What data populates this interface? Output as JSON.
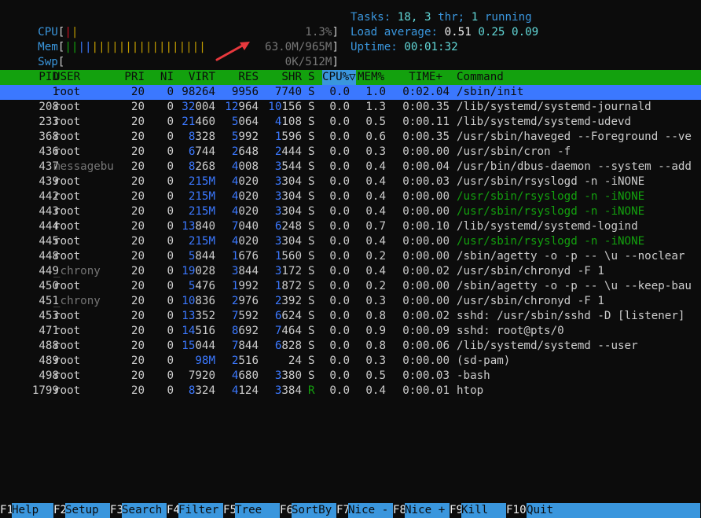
{
  "meters": {
    "cpu": {
      "label": "CPU",
      "value": "1.3%"
    },
    "mem": {
      "label": "Mem",
      "value": "63.0M/965M"
    },
    "swp": {
      "label": "Swp",
      "value": "0K/512M"
    }
  },
  "summary": {
    "tasks_label": "Tasks:",
    "tasks": "18,",
    "thr": "3",
    "thr_label": "thr;",
    "running": "1",
    "running_label": "running",
    "load_label": "Load average:",
    "load1": "0.51",
    "load5": "0.25",
    "load15": "0.09",
    "uptime_label": "Uptime:",
    "uptime": "00:01:32"
  },
  "columns": {
    "pid": "PID",
    "user": "USER",
    "pri": "PRI",
    "ni": "NI",
    "virt": "VIRT",
    "res": "RES",
    "shr": "SHR",
    "s": "S",
    "cpu": "CPU%▽",
    "mem": "MEM%",
    "time": "TIME+",
    "command": "Command"
  },
  "processes": [
    {
      "pid": "1",
      "user": "root",
      "pri": "20",
      "ni": "0",
      "virt_h": "98",
      "virt_t": "264",
      "res_h": "9",
      "res_t": "956",
      "shr_h": "7",
      "shr_t": "740",
      "s": "S",
      "cpu": "0.0",
      "mem": "1.0",
      "time": "0:02.04",
      "cmd": "/sbin/init"
    },
    {
      "pid": "208",
      "user": "root",
      "pri": "20",
      "ni": "0",
      "virt_h": "32",
      "virt_t": "004",
      "res_h": "12",
      "res_t": "964",
      "shr_h": "10",
      "shr_t": "156",
      "s": "S",
      "cpu": "0.0",
      "mem": "1.3",
      "time": "0:00.35",
      "cmd": "/lib/systemd/systemd-journald"
    },
    {
      "pid": "233",
      "user": "root",
      "pri": "20",
      "ni": "0",
      "virt_h": "21",
      "virt_t": "460",
      "res_h": "5",
      "res_t": "064",
      "shr_h": "4",
      "shr_t": "108",
      "s": "S",
      "cpu": "0.0",
      "mem": "0.5",
      "time": "0:00.11",
      "cmd": "/lib/systemd/systemd-udevd"
    },
    {
      "pid": "368",
      "user": "root",
      "pri": "20",
      "ni": "0",
      "virt_h": "8",
      "virt_t": "328",
      "res_h": "5",
      "res_t": "992",
      "shr_h": "1",
      "shr_t": "596",
      "s": "S",
      "cpu": "0.0",
      "mem": "0.6",
      "time": "0:00.35",
      "cmd": "/usr/sbin/haveged --Foreground --ve"
    },
    {
      "pid": "436",
      "user": "root",
      "pri": "20",
      "ni": "0",
      "virt_h": "6",
      "virt_t": "744",
      "res_h": "2",
      "res_t": "648",
      "shr_h": "2",
      "shr_t": "444",
      "s": "S",
      "cpu": "0.0",
      "mem": "0.3",
      "time": "0:00.00",
      "cmd": "/usr/sbin/cron -f"
    },
    {
      "pid": "437",
      "user": "messagebu",
      "pri": "20",
      "ni": "0",
      "virt_h": "8",
      "virt_t": "268",
      "res_h": "4",
      "res_t": "008",
      "shr_h": "3",
      "shr_t": "544",
      "s": "S",
      "cpu": "0.0",
      "mem": "0.4",
      "time": "0:00.04",
      "cmd": "/usr/bin/dbus-daemon --system --add"
    },
    {
      "pid": "439",
      "user": "root",
      "pri": "20",
      "ni": "0",
      "virt_h": "215M",
      "virt_t": "",
      "res_h": "4",
      "res_t": "020",
      "shr_h": "3",
      "shr_t": "304",
      "s": "S",
      "cpu": "0.0",
      "mem": "0.4",
      "time": "0:00.03",
      "cmd": "/usr/sbin/rsyslogd -n -iNONE"
    },
    {
      "pid": "442",
      "user": "root",
      "pri": "20",
      "ni": "0",
      "virt_h": "215M",
      "virt_t": "",
      "res_h": "4",
      "res_t": "020",
      "shr_h": "3",
      "shr_t": "304",
      "s": "S",
      "cpu": "0.0",
      "mem": "0.4",
      "time": "0:00.00",
      "cmd": "/usr/sbin/rsyslogd -n -iNONE",
      "thread": true
    },
    {
      "pid": "443",
      "user": "root",
      "pri": "20",
      "ni": "0",
      "virt_h": "215M",
      "virt_t": "",
      "res_h": "4",
      "res_t": "020",
      "shr_h": "3",
      "shr_t": "304",
      "s": "S",
      "cpu": "0.0",
      "mem": "0.4",
      "time": "0:00.00",
      "cmd": "/usr/sbin/rsyslogd -n -iNONE",
      "thread": true
    },
    {
      "pid": "444",
      "user": "root",
      "pri": "20",
      "ni": "0",
      "virt_h": "13",
      "virt_t": "840",
      "res_h": "7",
      "res_t": "040",
      "shr_h": "6",
      "shr_t": "248",
      "s": "S",
      "cpu": "0.0",
      "mem": "0.7",
      "time": "0:00.10",
      "cmd": "/lib/systemd/systemd-logind"
    },
    {
      "pid": "445",
      "user": "root",
      "pri": "20",
      "ni": "0",
      "virt_h": "215M",
      "virt_t": "",
      "res_h": "4",
      "res_t": "020",
      "shr_h": "3",
      "shr_t": "304",
      "s": "S",
      "cpu": "0.0",
      "mem": "0.4",
      "time": "0:00.00",
      "cmd": "/usr/sbin/rsyslogd -n -iNONE",
      "thread": true
    },
    {
      "pid": "448",
      "user": "root",
      "pri": "20",
      "ni": "0",
      "virt_h": "5",
      "virt_t": "844",
      "res_h": "1",
      "res_t": "676",
      "shr_h": "1",
      "shr_t": "560",
      "s": "S",
      "cpu": "0.0",
      "mem": "0.2",
      "time": "0:00.00",
      "cmd": "/sbin/agetty -o -p -- \\u --noclear"
    },
    {
      "pid": "449",
      "user": "_chrony",
      "pri": "20",
      "ni": "0",
      "virt_h": "19",
      "virt_t": "028",
      "res_h": "3",
      "res_t": "844",
      "shr_h": "3",
      "shr_t": "172",
      "s": "S",
      "cpu": "0.0",
      "mem": "0.4",
      "time": "0:00.02",
      "cmd": "/usr/sbin/chronyd -F 1"
    },
    {
      "pid": "450",
      "user": "root",
      "pri": "20",
      "ni": "0",
      "virt_h": "5",
      "virt_t": "476",
      "res_h": "1",
      "res_t": "992",
      "shr_h": "1",
      "shr_t": "872",
      "s": "S",
      "cpu": "0.0",
      "mem": "0.2",
      "time": "0:00.00",
      "cmd": "/sbin/agetty -o -p -- \\u --keep-bau"
    },
    {
      "pid": "451",
      "user": "_chrony",
      "pri": "20",
      "ni": "0",
      "virt_h": "10",
      "virt_t": "836",
      "res_h": "2",
      "res_t": "976",
      "shr_h": "2",
      "shr_t": "392",
      "s": "S",
      "cpu": "0.0",
      "mem": "0.3",
      "time": "0:00.00",
      "cmd": "/usr/sbin/chronyd -F 1"
    },
    {
      "pid": "453",
      "user": "root",
      "pri": "20",
      "ni": "0",
      "virt_h": "13",
      "virt_t": "352",
      "res_h": "7",
      "res_t": "592",
      "shr_h": "6",
      "shr_t": "624",
      "s": "S",
      "cpu": "0.0",
      "mem": "0.8",
      "time": "0:00.02",
      "cmd": "sshd: /usr/sbin/sshd -D [listener]"
    },
    {
      "pid": "471",
      "user": "root",
      "pri": "20",
      "ni": "0",
      "virt_h": "14",
      "virt_t": "516",
      "res_h": "8",
      "res_t": "692",
      "shr_h": "7",
      "shr_t": "464",
      "s": "S",
      "cpu": "0.0",
      "mem": "0.9",
      "time": "0:00.09",
      "cmd": "sshd: root@pts/0"
    },
    {
      "pid": "488",
      "user": "root",
      "pri": "20",
      "ni": "0",
      "virt_h": "15",
      "virt_t": "044",
      "res_h": "7",
      "res_t": "844",
      "shr_h": "6",
      "shr_t": "828",
      "s": "S",
      "cpu": "0.0",
      "mem": "0.8",
      "time": "0:00.06",
      "cmd": "/lib/systemd/systemd --user"
    },
    {
      "pid": "489",
      "user": "root",
      "pri": "20",
      "ni": "0",
      "virt_h": "98M",
      "virt_t": "",
      "res_h": "2",
      "res_t": "516",
      "shr_h": "",
      "shr_t": "24",
      "s": "S",
      "cpu": "0.0",
      "mem": "0.3",
      "time": "0:00.00",
      "cmd": "(sd-pam)"
    },
    {
      "pid": "498",
      "user": "root",
      "pri": "20",
      "ni": "0",
      "virt_h": "",
      "virt_t": "7920",
      "res_h": "4",
      "res_t": "680",
      "shr_h": "3",
      "shr_t": "380",
      "s": "S",
      "cpu": "0.0",
      "mem": "0.5",
      "time": "0:00.03",
      "cmd": "-bash"
    },
    {
      "pid": "1799",
      "user": "root",
      "pri": "20",
      "ni": "0",
      "virt_h": "8",
      "virt_t": "324",
      "res_h": "4",
      "res_t": "124",
      "shr_h": "3",
      "shr_t": "384",
      "s": "R",
      "cpu": "0.0",
      "mem": "0.4",
      "time": "0:00.01",
      "cmd": "htop"
    }
  ],
  "function_keys": [
    {
      "key": "F1",
      "label": "Help"
    },
    {
      "key": "F2",
      "label": "Setup"
    },
    {
      "key": "F3",
      "label": "Search"
    },
    {
      "key": "F4",
      "label": "Filter"
    },
    {
      "key": "F5",
      "label": "Tree"
    },
    {
      "key": "F6",
      "label": "SortBy"
    },
    {
      "key": "F7",
      "label": "Nice -"
    },
    {
      "key": "F8",
      "label": "Nice +"
    },
    {
      "key": "F9",
      "label": "Kill"
    },
    {
      "key": "F10",
      "label": "Quit"
    }
  ],
  "colors": {
    "header_bg": "#13a10e",
    "selected_bg": "#3b78ff",
    "fkey_label_bg": "#3a96dd",
    "arrow": "#e8383d"
  }
}
